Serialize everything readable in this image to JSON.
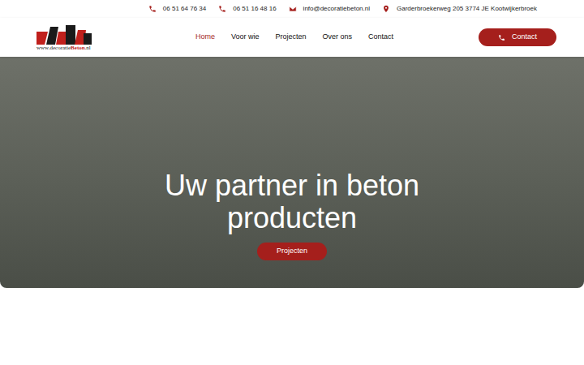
{
  "contact_bar": [
    {
      "kind": "phone",
      "text": "06 51 64 76 34"
    },
    {
      "kind": "phone",
      "text": "06 51 16 48 16"
    },
    {
      "kind": "mail",
      "text": "info@decoratiebeton.nl"
    },
    {
      "kind": "location",
      "text": "Garderbroekerweg 205 3774 JE Kootwijkerbroek"
    }
  ],
  "logo": {
    "prefix": "www.decoratie",
    "brand": "Beton",
    "suffix": ".nl"
  },
  "nav": [
    {
      "label": "Home",
      "selected": true
    },
    {
      "label": "Voor wie",
      "selected": false
    },
    {
      "label": "Projecten",
      "selected": false
    },
    {
      "label": "Over ons",
      "selected": false
    },
    {
      "label": "Contact",
      "selected": false
    }
  ],
  "cta": {
    "label": "Contact"
  },
  "hero": {
    "title": "Uw partner in beton producten",
    "button": "Projecten"
  }
}
